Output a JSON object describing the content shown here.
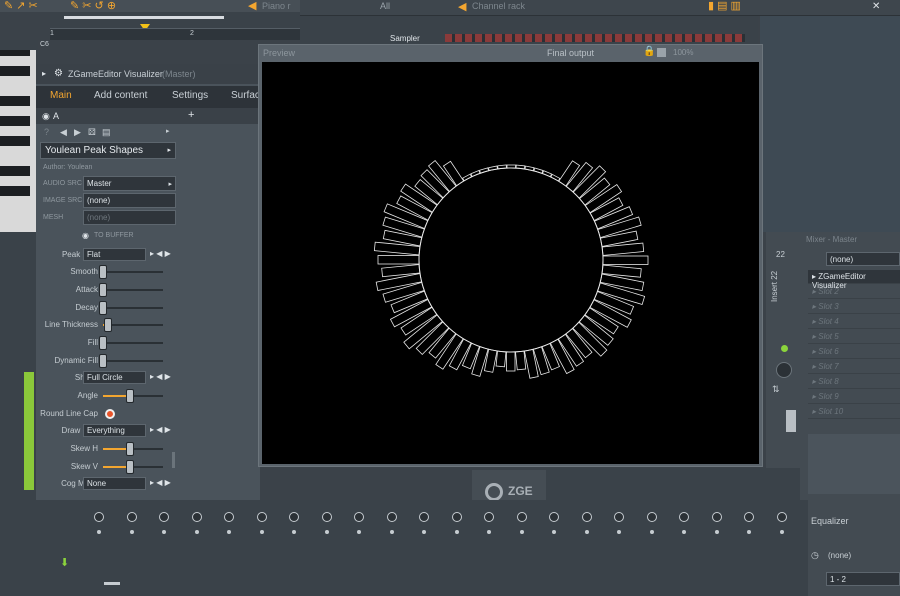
{
  "toolbar": {
    "piano_roll_label": "Piano r",
    "all_label": "All",
    "channel_rack_title": "Channel rack",
    "sampler_label": "Sampler"
  },
  "playlist": {
    "marker1": "1",
    "marker2": "2",
    "marker_c6": "C6"
  },
  "plugin": {
    "title": "ZGameEditor Visualizer",
    "title_suffix": "(Master)",
    "tabs": [
      "Main",
      "Add content",
      "Settings",
      "Surfac"
    ],
    "active_tab": "Main",
    "layer": "A",
    "preset": "Youlean Peak Shapes",
    "author": "Author: Youlean",
    "audio_src_label": "AUDIO SRC",
    "audio_src": "Master",
    "image_src_label": "IMAGE SRC",
    "image_src": "(none)",
    "mesh_label": "MESH",
    "mesh": "(none)",
    "to_buffer": "TO BUFFER",
    "params": [
      {
        "label": "Peak Mod",
        "kind": "dropdown",
        "value": "Flat"
      },
      {
        "label": "Smooth",
        "kind": "slider",
        "level": 0.0
      },
      {
        "label": "Attack",
        "kind": "slider",
        "level": 0.0
      },
      {
        "label": "Decay",
        "kind": "slider",
        "level": 0.0
      },
      {
        "label": "Line Thickness",
        "kind": "slider",
        "level": 0.08
      },
      {
        "label": "Fill",
        "kind": "slider",
        "level": 0.0
      },
      {
        "label": "Dynamic Fill",
        "kind": "slider",
        "level": 0.0
      },
      {
        "label": "Shape",
        "kind": "dropdown",
        "value": "Full Circle"
      },
      {
        "label": "Angle",
        "kind": "slider",
        "level": 0.45
      },
      {
        "label": "Round Line Cap",
        "kind": "toggle",
        "on": true
      },
      {
        "label": "Draw Mod",
        "kind": "dropdown",
        "value": "Everything"
      },
      {
        "label": "Skew H",
        "kind": "slider",
        "level": 0.45
      },
      {
        "label": "Skew V",
        "kind": "slider",
        "level": 0.45
      },
      {
        "label": "Cog Mode",
        "kind": "dropdown",
        "value": "None"
      }
    ],
    "accent": "#f3a630"
  },
  "preview": {
    "title": "Preview",
    "output_label": "Final output",
    "zoom": "100%",
    "logo": "ZGE"
  },
  "mixer": {
    "title": "Mixer - Master",
    "insert_label": "Insert 22",
    "insert_number": "22",
    "input": "(none)",
    "slots": [
      "ZGameEditor Visualizer",
      "Slot 2",
      "Slot 3",
      "Slot 4",
      "Slot 5",
      "Slot 6",
      "Slot 7",
      "Slot 8",
      "Slot 9",
      "Slot 10"
    ],
    "equalizer_label": "Equalizer",
    "output_none": "(none)",
    "route": "1 - 2"
  }
}
